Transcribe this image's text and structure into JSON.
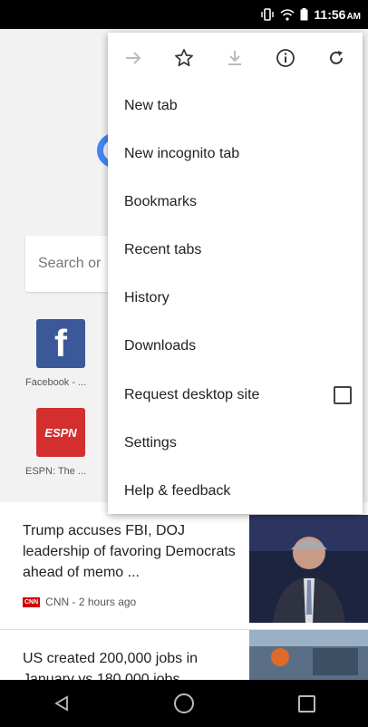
{
  "status_bar": {
    "time": "11:56",
    "ampm": "AM"
  },
  "page": {
    "search_placeholder": "Search or",
    "tiles": [
      {
        "label": "Facebook - ...",
        "glyph": "f",
        "color": "#3b5998"
      },
      {
        "label": "ESPN: The ...",
        "glyph": "ESPN",
        "color": "#d32f2f"
      }
    ]
  },
  "news": [
    {
      "title": "Trump accuses FBI, DOJ leadership of favoring Democrats ahead of memo ...",
      "source": "CNN - 2 hours ago",
      "badge": "CNN"
    },
    {
      "title": "US created 200,000 jobs in January vs 180,000 jobs",
      "source": ""
    }
  ],
  "menu": {
    "toolbar": [
      "forward-icon",
      "bookmark-star-icon",
      "download-icon",
      "info-icon",
      "refresh-icon"
    ],
    "items": [
      "New tab",
      "New incognito tab",
      "Bookmarks",
      "Recent tabs",
      "History",
      "Downloads",
      "Request desktop site",
      "Settings",
      "Help & feedback"
    ]
  }
}
